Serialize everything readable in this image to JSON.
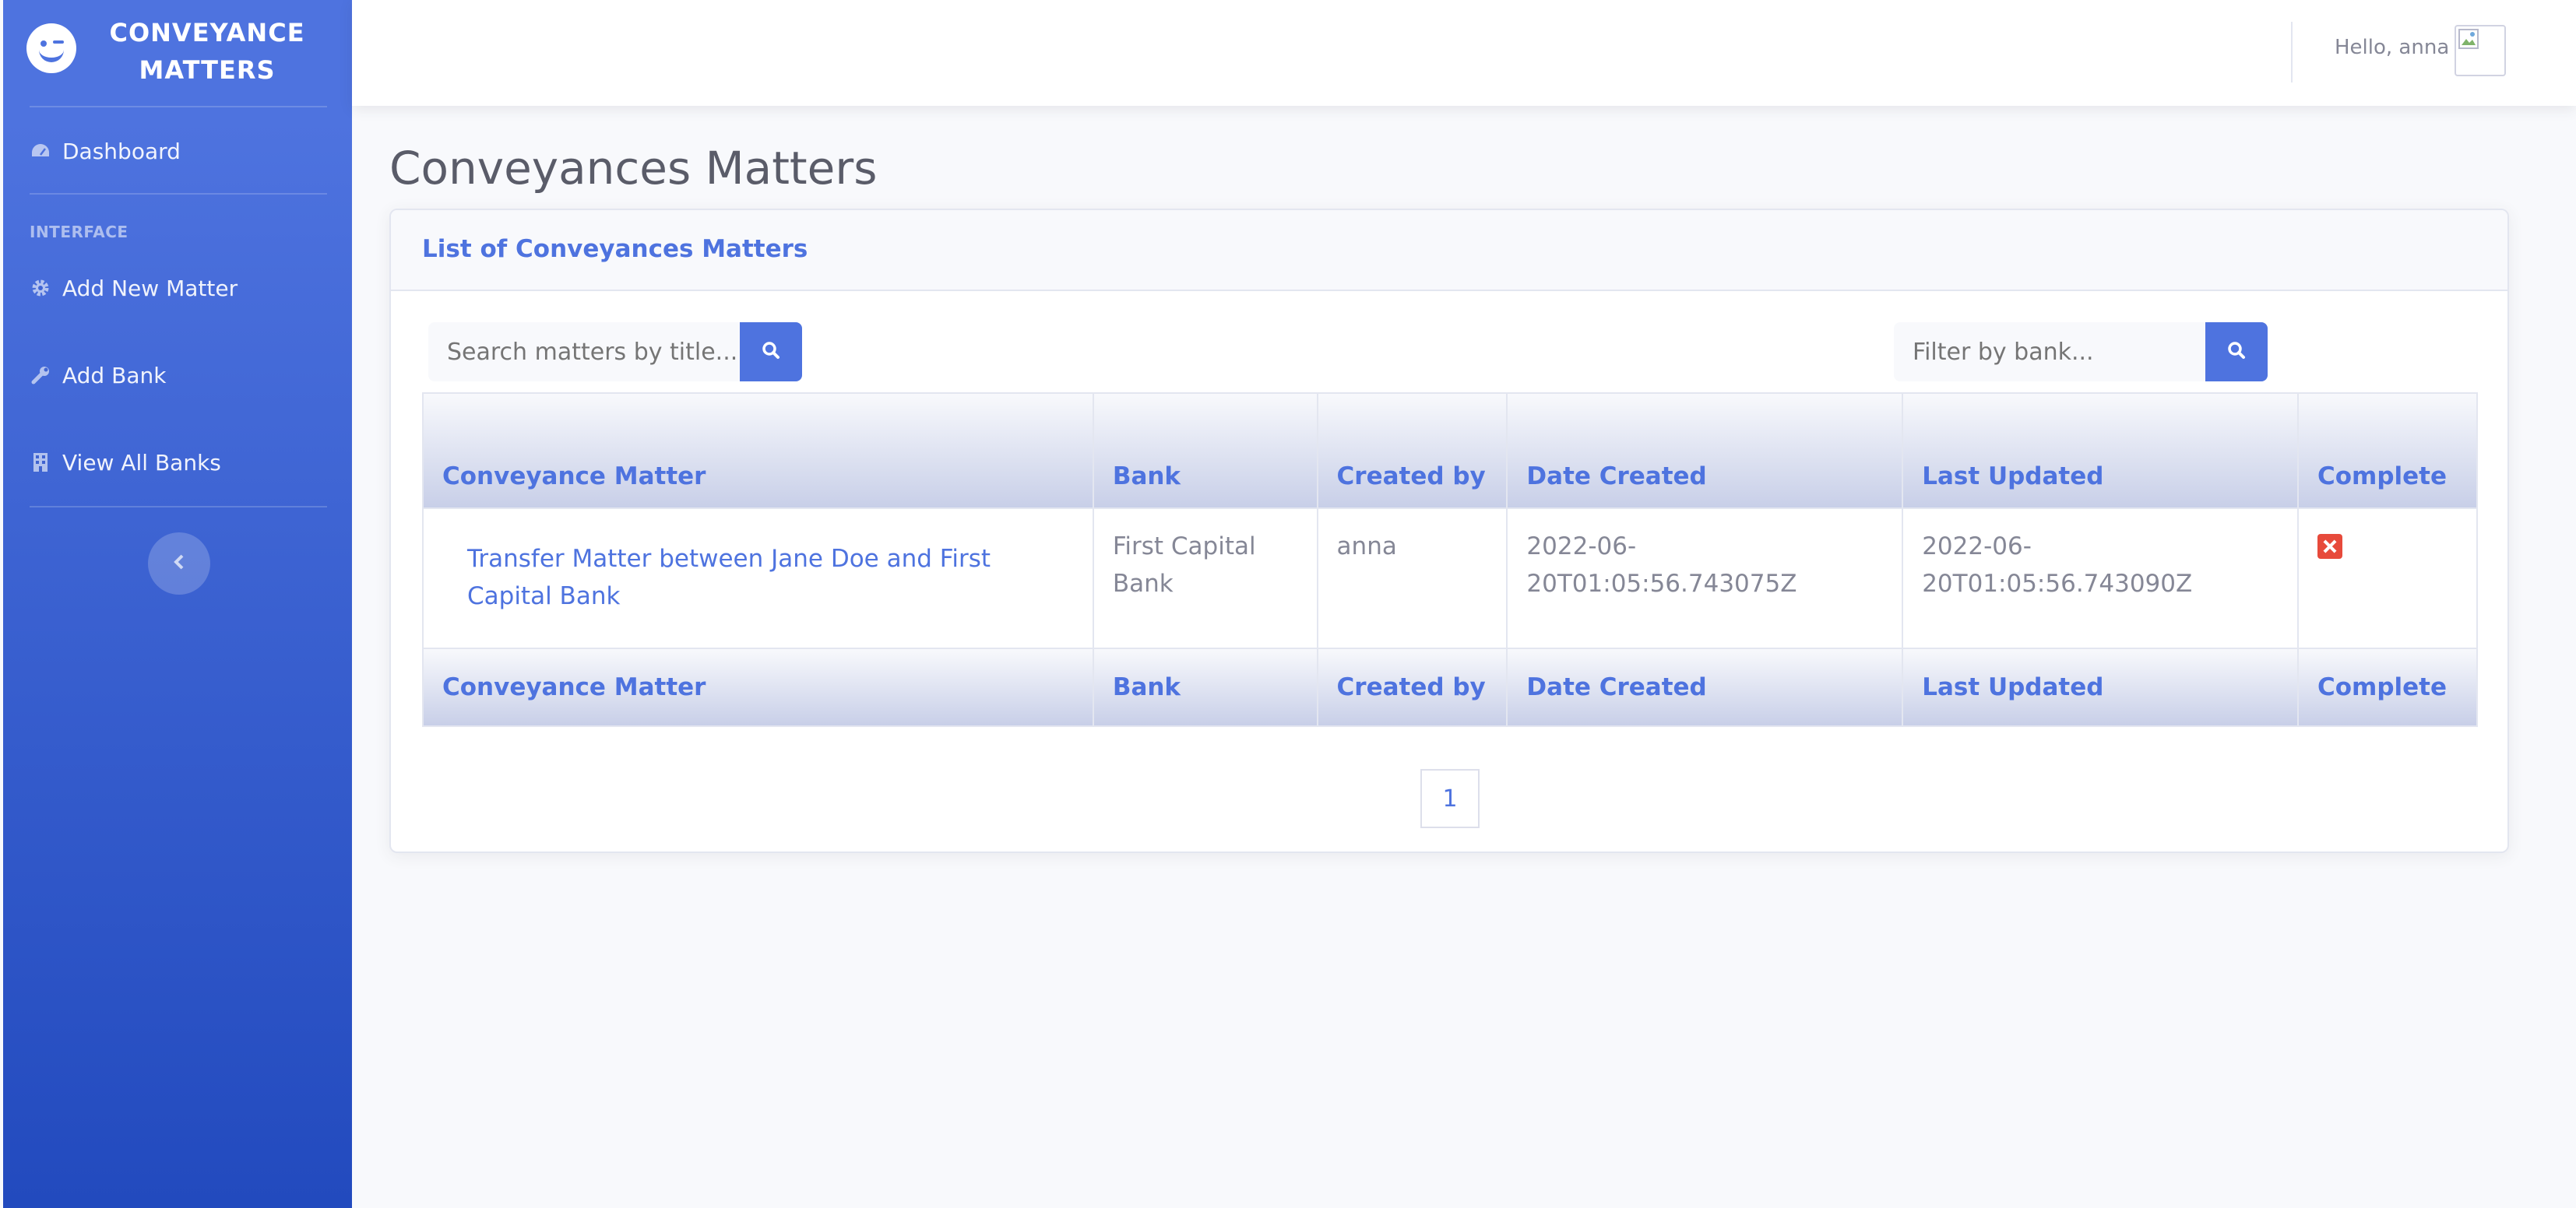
{
  "sidebar": {
    "brand": "CONVEYANCE MATTERS",
    "items": [
      {
        "label": "Dashboard",
        "icon": "tachometer-icon"
      },
      {
        "label": "Add New Matter",
        "icon": "gear-icon"
      },
      {
        "label": "Add Bank",
        "icon": "wrench-icon"
      },
      {
        "label": "View All Banks",
        "icon": "building-icon"
      }
    ],
    "section_heading": "INTERFACE",
    "toggle_icon": "chevron-left-icon"
  },
  "topbar": {
    "greeting": "Hello, anna"
  },
  "main": {
    "page_title": "Conveyances Matters",
    "card_title": "List of Conveyances Matters",
    "search": {
      "placeholder": "Search matters by title..."
    },
    "filter": {
      "placeholder": "Filter by bank..."
    },
    "table": {
      "headers": [
        "Conveyance Matter",
        "Bank",
        "Created by",
        "Date Created",
        "Last Updated",
        "Complete"
      ],
      "rows": [
        {
          "matter": "Transfer Matter between Jane Doe and First Capital Bank",
          "bank": "First Capital Bank",
          "created_by": "anna",
          "date_created": "2022-06-20T01:05:56.743075Z",
          "last_updated": "2022-06-20T01:05:56.743090Z",
          "complete": "false"
        }
      ]
    },
    "pagination": {
      "current": "1"
    }
  },
  "colors": {
    "primary": "#4e73df",
    "danger": "#e74a3b",
    "sidebar_gradient_start": "#4e73df",
    "sidebar_gradient_end": "#224abe"
  }
}
